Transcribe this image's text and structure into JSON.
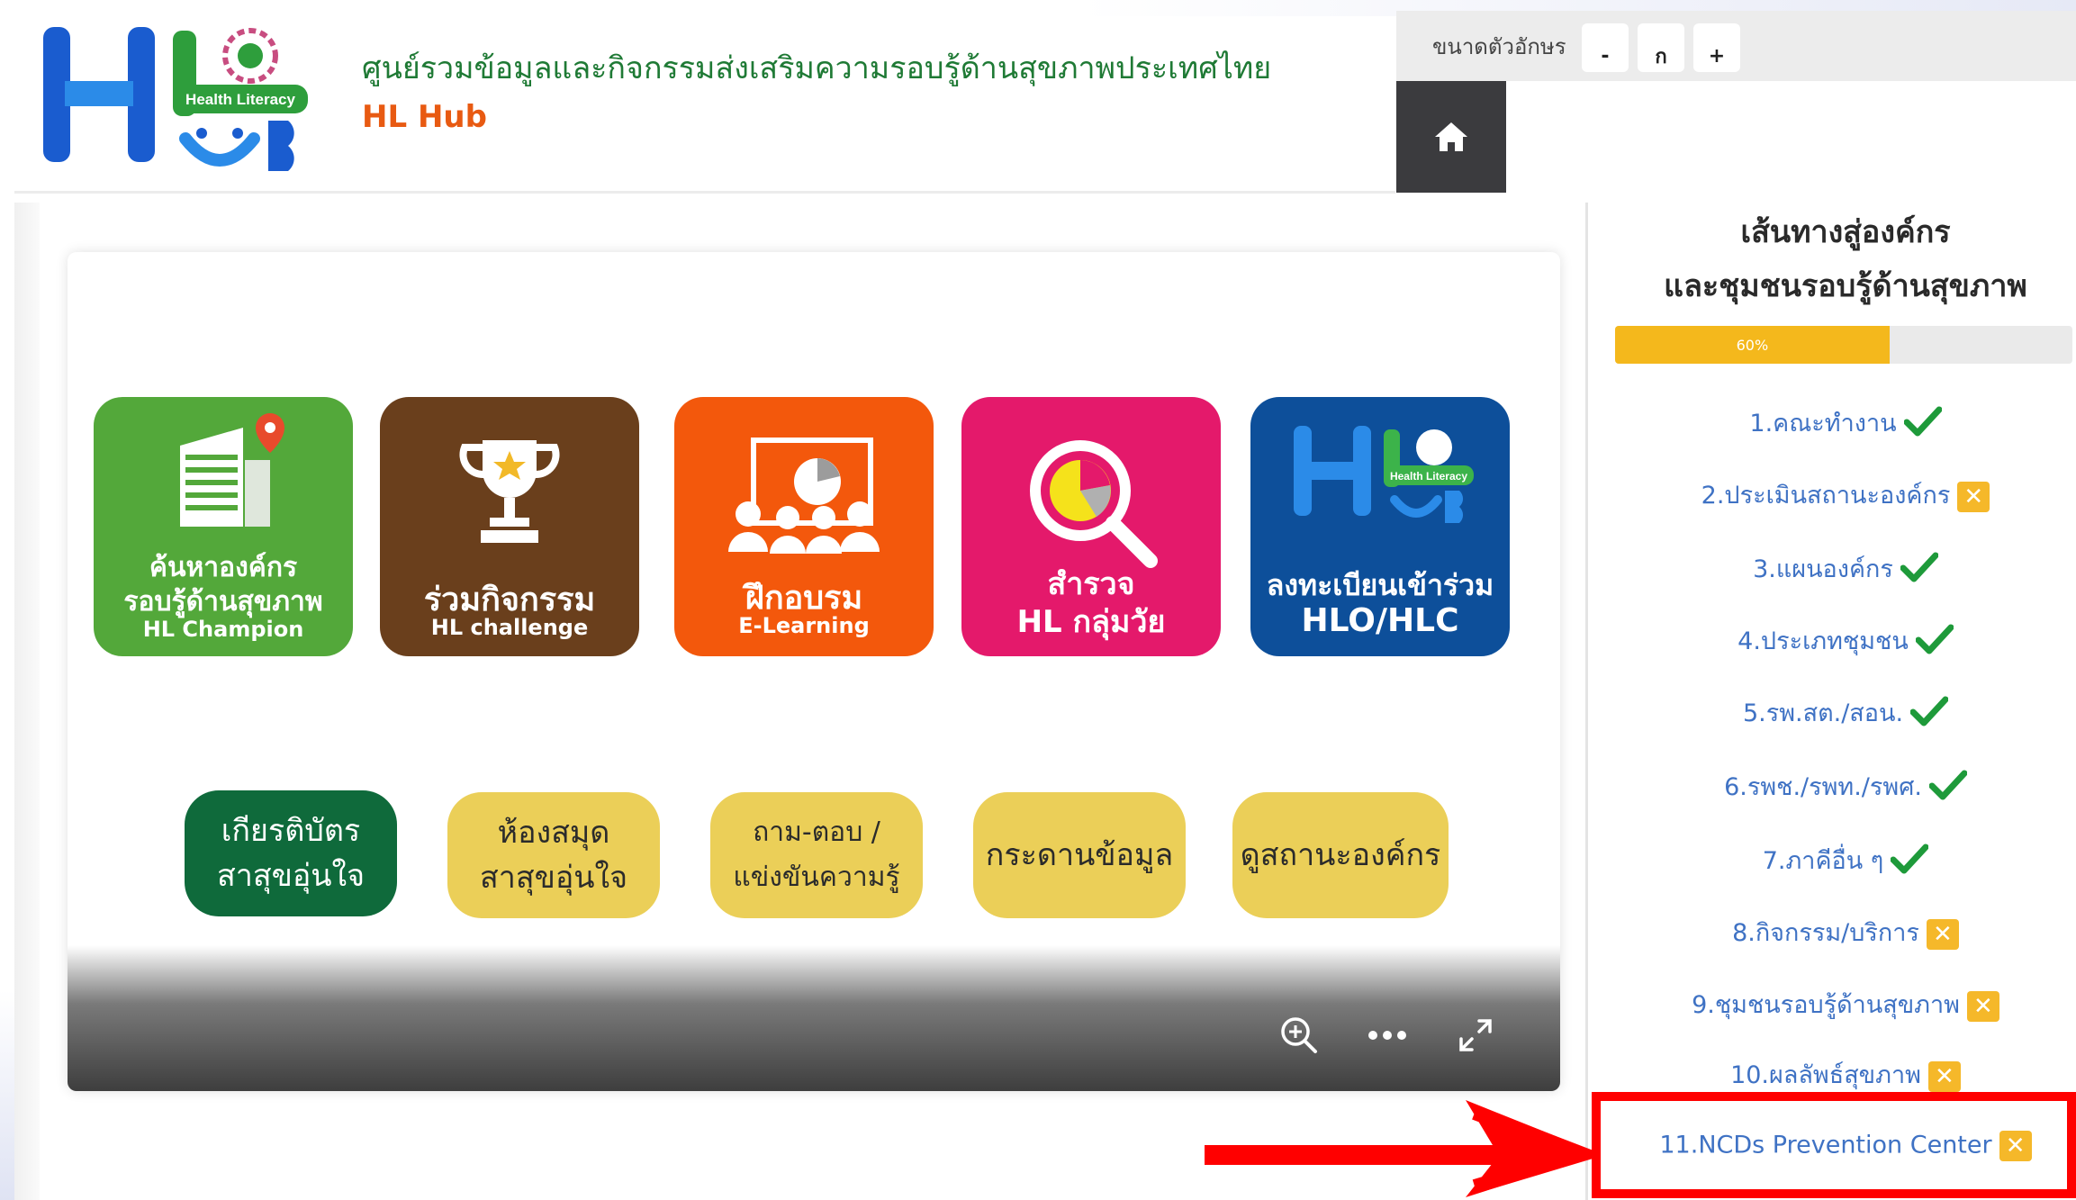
{
  "header": {
    "logo_text": "Health Literacy",
    "site_title": "ศูนย์รวมข้อมูลและกิจกรรมส่งเสริมความรอบรู้ด้านสุขภาพประเทศไทย",
    "site_subtitle": "HL Hub"
  },
  "font_size_bar": {
    "label": "ขนาดตัวอักษร",
    "decrease": "-",
    "normal": "ก",
    "increase": "+"
  },
  "home_icon": "home-icon",
  "tiles": [
    {
      "line1": "ค้นหาองค์กร",
      "line2": "รอบรู้ด้านสุขภาพ",
      "line3": "HL Champion",
      "color": "#53a83a",
      "icon": "building-pin-icon"
    },
    {
      "line1": "ร่วมกิจกรรม",
      "line2": "HL challenge",
      "color": "#6a3f1c",
      "icon": "trophy-icon"
    },
    {
      "line1": "ฝึกอบรม",
      "line2": "E-Learning",
      "color": "#f3580c",
      "icon": "training-icon"
    },
    {
      "line1": "สำรวจ",
      "line2": "HL กลุ่มวัย",
      "color": "#e4196b",
      "icon": "search-chart-icon"
    },
    {
      "line1": "ลงทะเบียนเข้าร่วม",
      "line2": "HLO/HLC",
      "logo_text": "Health Literacy",
      "color": "#0d4f9a",
      "icon": "hl-hub-logo-icon"
    }
  ],
  "pills": [
    {
      "line1": "เกียรติบัตร",
      "line2": "สาสุขอุ่นใจ",
      "color": "#0f6a3b"
    },
    {
      "line1": "ห้องสมุด",
      "line2": "สาสุขอุ่นใจ",
      "color": "#ebcf58"
    },
    {
      "line1": "ถาม-ตอบ /",
      "line2": "แข่งขันความรู้",
      "color": "#ebcf58"
    },
    {
      "line1": "กระดานข้อมูล",
      "color": "#ebcf58"
    },
    {
      "line1": "ดูสถานะองค์กร",
      "color": "#ebcf58"
    }
  ],
  "viewer_controls": [
    "zoom-in-icon",
    "more-icon",
    "fullscreen-icon"
  ],
  "sidebar": {
    "title_line1": "เส้นทางสู่องค์กร",
    "title_line2": "และชุมชนรอบรู้ด้านสุขภาพ",
    "progress_label": "60%",
    "progress_value": 0.6,
    "steps": [
      {
        "label": "1.คณะทำงาน",
        "status": "done"
      },
      {
        "label": "2.ประเมินสถานะองค์กร",
        "status": "pending"
      },
      {
        "label": "3.แผนองค์กร",
        "status": "done"
      },
      {
        "label": "4.ประเภทชุมชน",
        "status": "done"
      },
      {
        "label": "5.รพ.สต./สอน.",
        "status": "done"
      },
      {
        "label": "6.รพช./รพท./รพศ.",
        "status": "done"
      },
      {
        "label": "7.ภาคีอื่น ๆ",
        "status": "done"
      },
      {
        "label": "8.กิจกรรม/บริการ",
        "status": "pending"
      },
      {
        "label": "9.ชุมชนรอบรู้ด้านสุขภาพ",
        "status": "pending"
      },
      {
        "label": "10.ผลลัพธ์สุขภาพ",
        "status": "pending"
      },
      {
        "label": "11.NCDs Prevention Center",
        "status": "pending"
      }
    ]
  },
  "colors": {
    "check": "#1e9a3a",
    "pending": "#f5b82a",
    "highlight": "#ff0000"
  }
}
